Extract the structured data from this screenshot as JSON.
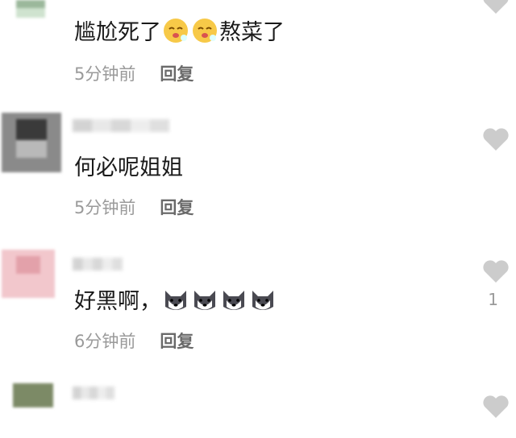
{
  "comments": [
    {
      "text_before": "尴尬死了",
      "text_after": "熬菜了",
      "emoji_icon": "sleepy-face-icon",
      "emoji_count": 2,
      "time": "5分钟前",
      "reply_label": "回复",
      "like_count": ""
    },
    {
      "text_before": "何必呢姐姐",
      "text_after": "",
      "emoji_icon": "",
      "emoji_count": 0,
      "time": "5分钟前",
      "reply_label": "回复",
      "like_count": ""
    },
    {
      "text_before": "好黑啊，",
      "text_after": "",
      "emoji_icon": "husky-dog-face-icon",
      "emoji_count": 4,
      "time": "6分钟前",
      "reply_label": "回复",
      "like_count": "1"
    }
  ],
  "colors": {
    "like_icon": "#cccccc",
    "meta_text": "#9a9a9a",
    "reply_text": "#6a6a6a",
    "body_text": "#1a1a1a"
  }
}
